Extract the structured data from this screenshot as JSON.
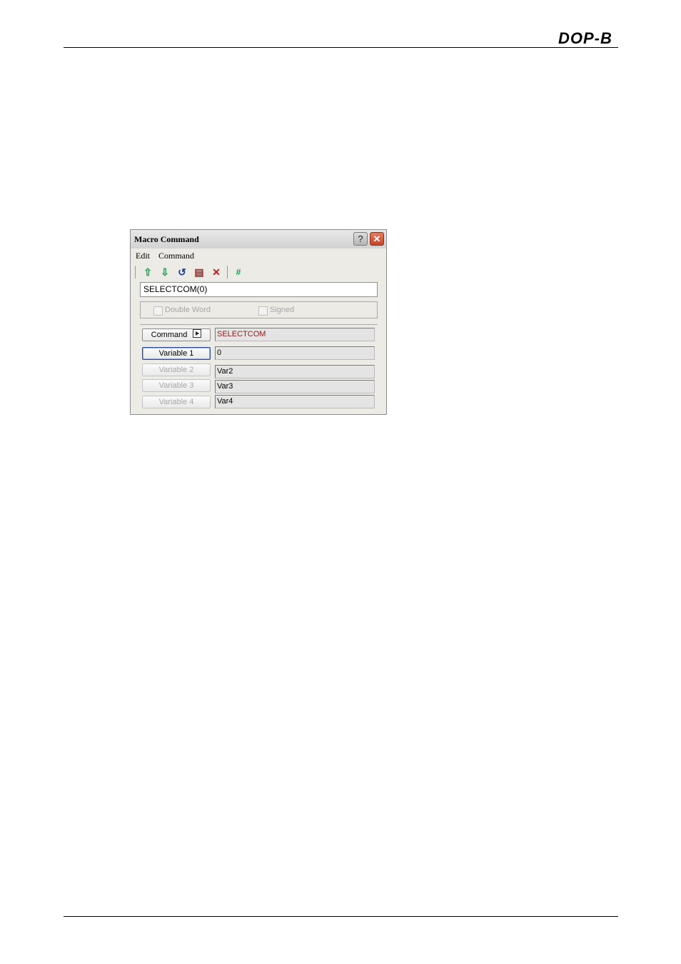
{
  "header": {
    "logo_text": "DOP-B"
  },
  "dialog": {
    "title": "Macro Command",
    "help_glyph": "?",
    "close_glyph": "✕",
    "menu": [
      {
        "label": "Edit"
      },
      {
        "label": "Command"
      }
    ],
    "toolbar": {
      "icons": [
        "up-arrow-icon",
        "down-arrow-icon",
        "undo-icon",
        "document-icon",
        "delete-icon",
        "hash-icon"
      ],
      "glyphs": {
        "up": "⇧",
        "down": "⇩",
        "undo": "↺",
        "doc": "▤",
        "delete": "✕",
        "hash": "#"
      },
      "colors": {
        "up": "#1a9a4a",
        "down": "#1a9a4a",
        "undo": "#1c3f8f",
        "doc": "#b21e1e",
        "delete": "#c01a1a",
        "hash": "#1a9a4a"
      }
    },
    "expression": "SELECTCOM(0)",
    "options": {
      "double_word": {
        "label": "Double Word",
        "checked": false,
        "enabled": false
      },
      "signed": {
        "label": "Signed",
        "checked": false,
        "enabled": false
      }
    },
    "params": [
      {
        "button": "Command",
        "value": "SELECTCOM",
        "enabled": true
      },
      {
        "button": "Variable 1",
        "value": "0",
        "enabled": true
      },
      {
        "button": "Variable 2",
        "value": "Var2",
        "enabled": false
      },
      {
        "button": "Variable 3",
        "value": "Var3",
        "enabled": false
      },
      {
        "button": "Variable 4",
        "value": "Var4",
        "enabled": false
      }
    ]
  }
}
